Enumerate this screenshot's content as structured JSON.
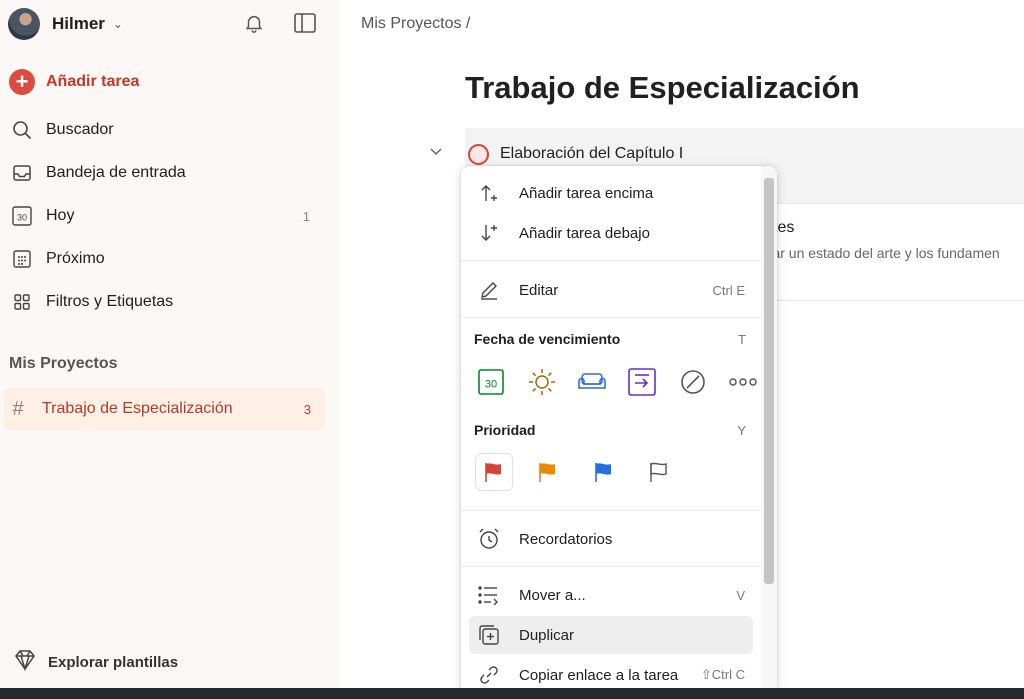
{
  "sidebar": {
    "user_name": "Hilmer",
    "add_task": "Añadir tarea",
    "items": [
      {
        "label": "Buscador",
        "count": ""
      },
      {
        "label": "Bandeja de entrada",
        "count": ""
      },
      {
        "label": "Hoy",
        "count": "1",
        "icon_text": "30"
      },
      {
        "label": "Próximo",
        "count": ""
      },
      {
        "label": "Filtros y Etiquetas",
        "count": ""
      }
    ],
    "section_title": "Mis Proyectos",
    "project": {
      "label": "Trabajo de Especialización",
      "count": "3"
    },
    "templates": "Explorar plantillas"
  },
  "main": {
    "breadcrumb": "Mis Proyectos /",
    "title": "Trabajo de Especialización",
    "task_title": "Elaboración del Capítulo I",
    "subtask_title_partial": "tes",
    "subtask_desc_partial": "orar un estado del arte y los fundamen"
  },
  "menu": {
    "add_above": "Añadir tarea encima",
    "add_below": "Añadir tarea debajo",
    "edit": "Editar",
    "edit_shortcut": "Ctrl E",
    "due_date": "Fecha de vencimiento",
    "due_date_shortcut": "T",
    "date_icon_text": "30",
    "priority": "Prioridad",
    "priority_shortcut": "Y",
    "reminders": "Recordatorios",
    "move": "Mover a...",
    "move_shortcut": "V",
    "duplicate": "Duplicar",
    "copy_link": "Copiar enlace a la tarea",
    "copy_link_shortcut": "⇧Ctrl C"
  },
  "colors": {
    "accent": "#dc4c3e",
    "priority_1": "#d1453b",
    "priority_2": "#eb8909",
    "priority_3": "#246fe0",
    "date_today": "#058527",
    "date_tomorrow": "#ad6200",
    "date_weekend": "#246fe0",
    "date_next_week": "#692ec2"
  }
}
